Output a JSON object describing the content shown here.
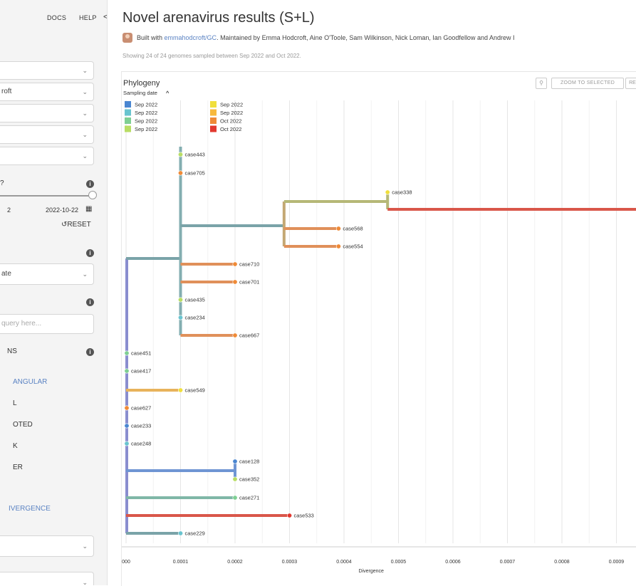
{
  "nav": {
    "docs": "DOCS",
    "help": "HELP",
    "collapse": "<"
  },
  "sidebar": {
    "dropdowns": [
      {
        "value": ""
      },
      {
        "value": "roft"
      },
      {
        "value": ""
      },
      {
        "value": ""
      },
      {
        "value": ""
      }
    ],
    "date_start": "2",
    "date_end": "2022-10-22",
    "reset_label": "RESET",
    "color_by": "ate",
    "search_placeholder": "query here...",
    "section_ns": "NS",
    "layouts": [
      "ANGULAR",
      "L",
      "OTED",
      "K",
      "ER"
    ],
    "branch_length": "IVERGENCE"
  },
  "header": {
    "title": "Novel arenavirus results (S+L)",
    "built_with": "Built with",
    "link": "emmahodcroft/GC",
    "maintained": ". Maintained by Emma Hodcroft, Aine O'Toole, Sam Wilkinson, Nick Loman, Ian Goodfellow and Andrew I",
    "showing": "Showing 24 of 24 genomes sampled between Sep 2022 and Oct 2022."
  },
  "panel": {
    "title": "Phylogeny",
    "zoom_label": "ZOOM TO SELECTED",
    "reset_layout": "RE",
    "legend_title": "Sampling date",
    "legend": [
      {
        "label": "Sep 2022",
        "color": "#4a86d1"
      },
      {
        "label": "Sep 2022",
        "color": "#69c4cf"
      },
      {
        "label": "Sep 2022",
        "color": "#7fcf93"
      },
      {
        "label": "Sep 2022",
        "color": "#b8dd64"
      },
      {
        "label": "Sep 2022",
        "color": "#f0df3c"
      },
      {
        "label": "Sep 2022",
        "color": "#f7b93d"
      },
      {
        "label": "Oct 2022",
        "color": "#ef8a37"
      },
      {
        "label": "Oct 2022",
        "color": "#e2382f"
      }
    ]
  },
  "chart_data": {
    "type": "tree",
    "xlabel": "Divergence",
    "xticks": [
      "000",
      "0.0001",
      "0.0002",
      "0.0003",
      "0.0004",
      "0.0005",
      "0.0006",
      "0.0007",
      "0.0008",
      "0.0009"
    ],
    "tips": [
      {
        "name": "case443",
        "div": 0.0001,
        "color": "#b8dd64"
      },
      {
        "name": "case705",
        "div": 0.0001,
        "color": "#ef8a37"
      },
      {
        "name": "case338",
        "div": 0.00048,
        "color": "#f0df3c"
      },
      {
        "name": "case568",
        "div": 0.00039,
        "color": "#ef8a37"
      },
      {
        "name": "case554",
        "div": 0.00039,
        "color": "#ef8a37"
      },
      {
        "name": "case710",
        "div": 0.0002,
        "color": "#ef8a37"
      },
      {
        "name": "case701",
        "div": 0.0002,
        "color": "#ef8a37"
      },
      {
        "name": "case435",
        "div": 0.0001,
        "color": "#b8dd64"
      },
      {
        "name": "case234",
        "div": 0.0001,
        "color": "#69c4cf"
      },
      {
        "name": "case667",
        "div": 0.0002,
        "color": "#ef8a37"
      },
      {
        "name": "case451",
        "div": 0.0,
        "color": "#7fcf93"
      },
      {
        "name": "case417",
        "div": 0.0,
        "color": "#7fcf93"
      },
      {
        "name": "case549",
        "div": 0.0001,
        "color": "#f0df3c"
      },
      {
        "name": "case627",
        "div": 0.0,
        "color": "#ef8a37"
      },
      {
        "name": "case233",
        "div": 0.0,
        "color": "#4a86d1"
      },
      {
        "name": "case248",
        "div": 0.0,
        "color": "#69c4cf"
      },
      {
        "name": "case128",
        "div": 0.0002,
        "color": "#4a86d1"
      },
      {
        "name": "case352",
        "div": 0.0002,
        "color": "#b8dd64"
      },
      {
        "name": "case271",
        "div": 0.0002,
        "color": "#7fcf93"
      },
      {
        "name": "case533",
        "div": 0.0003,
        "color": "#e2382f"
      },
      {
        "name": "case229",
        "div": 0.0001,
        "color": "#69c4cf"
      }
    ]
  }
}
